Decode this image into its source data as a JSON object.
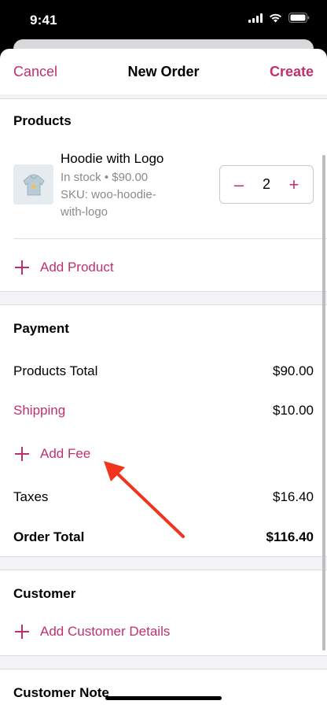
{
  "status_bar": {
    "time": "9:41",
    "icons": [
      "signal-icon",
      "wifi-icon",
      "battery-icon"
    ]
  },
  "nav": {
    "cancel_label": "Cancel",
    "title": "New Order",
    "create_label": "Create"
  },
  "products": {
    "section_title": "Products",
    "item": {
      "name": "Hoodie with Logo",
      "stock_price": "In stock • $90.00",
      "sku_line1": "SKU: woo-hoodie-",
      "sku_line2": "with-logo",
      "quantity": "2"
    },
    "add_label": "Add Product"
  },
  "payment": {
    "section_title": "Payment",
    "products_total_label": "Products Total",
    "products_total_value": "$90.00",
    "shipping_label": "Shipping",
    "shipping_value": "$10.00",
    "add_fee_label": "Add Fee",
    "taxes_label": "Taxes",
    "taxes_value": "$16.40",
    "order_total_label": "Order Total",
    "order_total_value": "$116.40"
  },
  "customer": {
    "section_title": "Customer",
    "add_label": "Add Customer Details"
  },
  "customer_note": {
    "section_title": "Customer Note"
  },
  "colors": {
    "accent": "#c0306e",
    "annotation_arrow": "#f2341f",
    "band": "#f2f2f7"
  }
}
